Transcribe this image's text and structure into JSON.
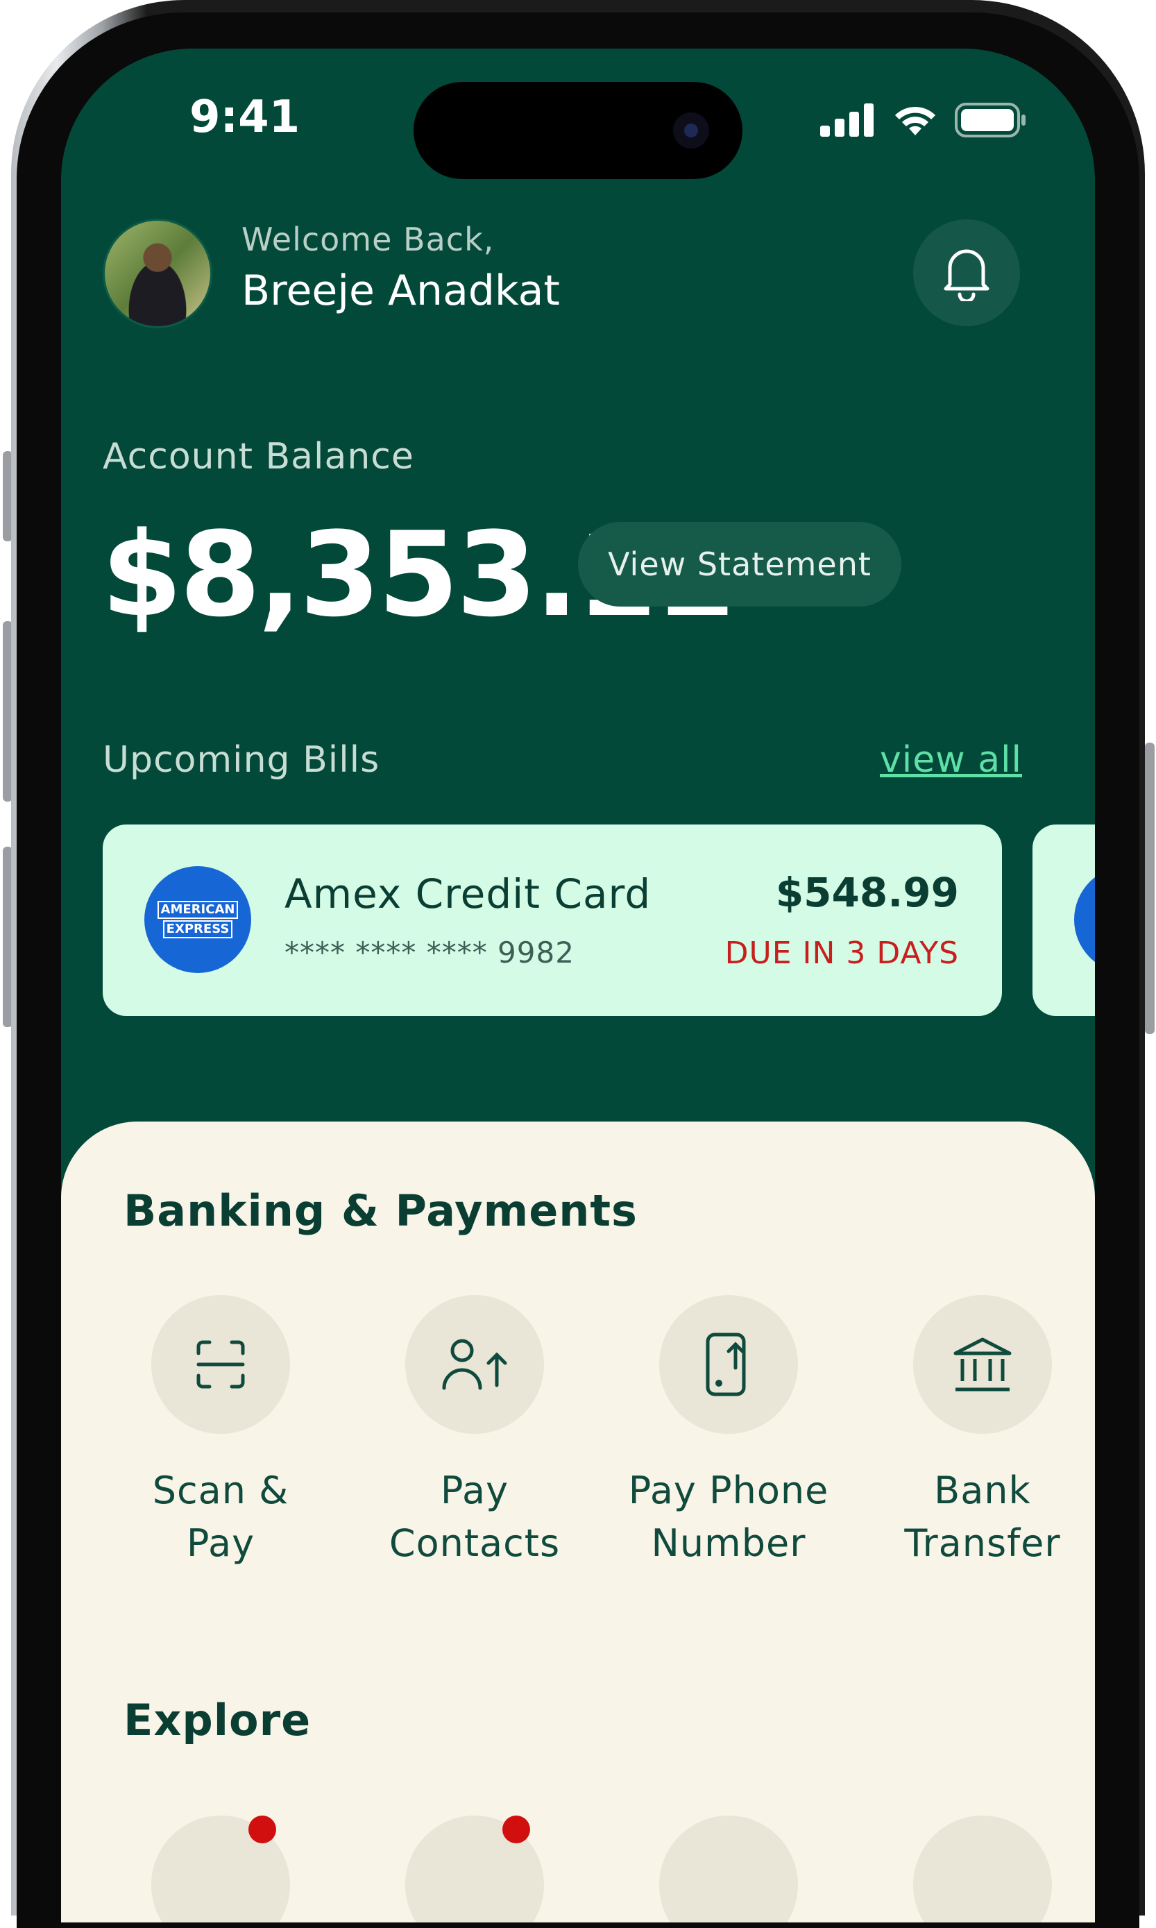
{
  "status_bar": {
    "time": "9:41"
  },
  "header": {
    "welcome": "Welcome Back,",
    "name": "Breeje Anadkat"
  },
  "balance": {
    "label": "Account Balance",
    "amount": "$8,353.11",
    "view_statement": "View Statement"
  },
  "bills": {
    "title": "Upcoming Bills",
    "view_all": "view all",
    "items": [
      {
        "name": "Amex Credit Card",
        "masked_number": "**** **** **** 9982",
        "amount": "$548.99",
        "due": "DUE IN 3 DAYS",
        "logo_line1": "AMERICAN",
        "logo_line2": "EXPRESS"
      }
    ]
  },
  "banking": {
    "title": "Banking & Payments",
    "actions": [
      {
        "line1": "Scan &",
        "line2": "Pay",
        "icon": "scan-icon"
      },
      {
        "line1": "Pay",
        "line2": "Contacts",
        "icon": "contact-send-icon"
      },
      {
        "line1": "Pay Phone",
        "line2": "Number",
        "icon": "phone-send-icon"
      },
      {
        "line1": "Bank",
        "line2": "Transfer",
        "icon": "bank-icon"
      }
    ]
  },
  "explore": {
    "title": "Explore"
  },
  "colors": {
    "primary": "#034939",
    "accent": "#5fe0a6",
    "card": "#d3fbe6",
    "sheet": "#f8f4e8",
    "due": "#c81e1e"
  }
}
